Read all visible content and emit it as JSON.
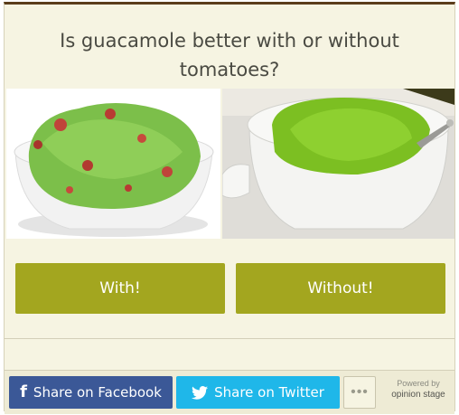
{
  "poll": {
    "question": "Is guacamole better with or without tomatoes?",
    "answers": [
      {
        "label": "With!"
      },
      {
        "label": "Without!"
      }
    ]
  },
  "share": {
    "facebook_label": "Share on Facebook",
    "twitter_label": "Share on Twitter",
    "more_label": "•••"
  },
  "footer": {
    "powered_by": "Powered by",
    "brand": "opinion stage"
  },
  "colors": {
    "accent": "#a3a61f",
    "facebook": "#3b5897",
    "twitter": "#1fb7e9",
    "background": "#f6f4e2",
    "top_border": "#5b3d1b"
  },
  "icons": [
    "facebook-icon",
    "twitter-icon",
    "more-icon"
  ]
}
